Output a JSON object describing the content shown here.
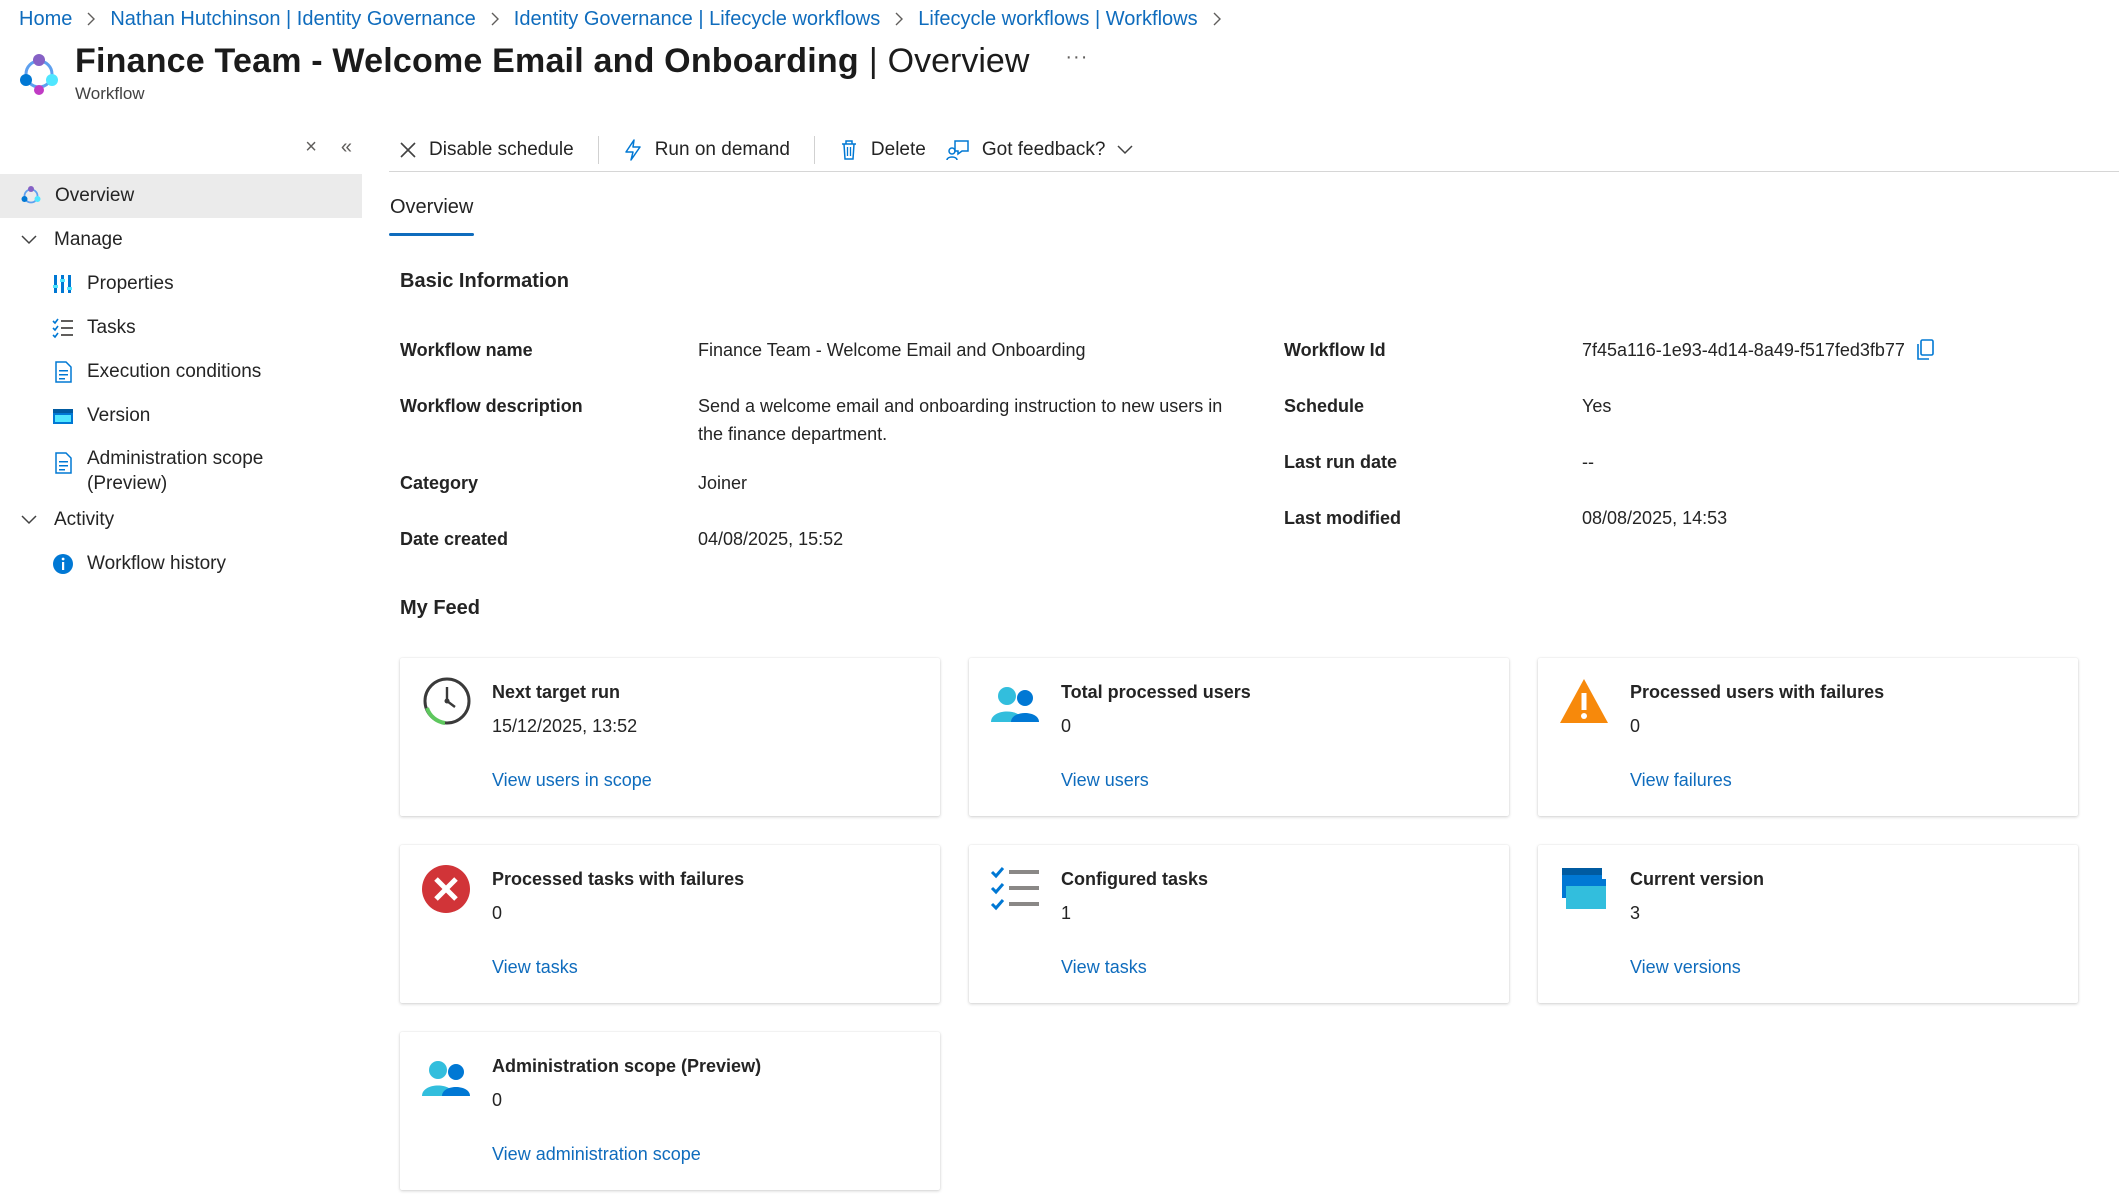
{
  "breadcrumb": [
    {
      "label": "Home"
    },
    {
      "label": "Nathan Hutchinson | Identity Governance"
    },
    {
      "label": "Identity Governance | Lifecycle workflows"
    },
    {
      "label": "Lifecycle workflows | Workflows"
    }
  ],
  "header": {
    "title": "Finance Team - Welcome Email and Onboarding",
    "separator": "|",
    "subtitle": "Overview",
    "kind": "Workflow",
    "more_label": "···"
  },
  "nav_controls": {
    "close": "×",
    "collapse": "«"
  },
  "sidenav": {
    "overview": "Overview",
    "manage": "Manage",
    "properties": "Properties",
    "tasks": "Tasks",
    "execution_conditions": "Execution conditions",
    "version": "Version",
    "admin_scope_line1": "Administration scope",
    "admin_scope_line2": "(Preview)",
    "activity": "Activity",
    "workflow_history": "Workflow history"
  },
  "toolbar": {
    "disable_schedule": "Disable schedule",
    "run_on_demand": "Run on demand",
    "delete": "Delete",
    "feedback": "Got feedback?"
  },
  "tabs": [
    {
      "label": "Overview"
    }
  ],
  "basic_info": {
    "title": "Basic Information",
    "workflow_name_label": "Workflow name",
    "workflow_name": "Finance Team - Welcome Email and Onboarding",
    "workflow_description_label": "Workflow description",
    "workflow_description_line1": "Send a welcome email and onboarding instruction to new users in",
    "workflow_description_line2": "the finance department.",
    "category_label": "Category",
    "category": "Joiner",
    "date_created_label": "Date created",
    "date_created": "04/08/2025, 15:52",
    "workflow_id_label": "Workflow Id",
    "workflow_id": "7f45a116-1e93-4d14-8a49-f517fed3fb77",
    "schedule_label": "Schedule",
    "schedule": "Yes",
    "last_run_date_label": "Last run date",
    "last_run_date": "--",
    "last_modified_label": "Last modified",
    "last_modified": "08/08/2025, 14:53"
  },
  "feed": {
    "title": "My Feed",
    "cards": [
      {
        "icon": "clock-icon",
        "title": "Next target run",
        "value": "15/12/2025, 13:52",
        "link": "View users in scope"
      },
      {
        "icon": "users-icon",
        "title": "Total processed users",
        "value": "0",
        "link": "View users"
      },
      {
        "icon": "warning-icon",
        "title": "Processed users with failures",
        "value": "0",
        "link": "View failures"
      },
      {
        "icon": "error-icon",
        "title": "Processed tasks with failures",
        "value": "0",
        "link": "View tasks"
      },
      {
        "icon": "task-list-icon",
        "title": "Configured tasks",
        "value": "1",
        "link": "View tasks"
      },
      {
        "icon": "version-icon",
        "title": "Current version",
        "value": "3",
        "link": "View versions"
      },
      {
        "icon": "admin-users-icon",
        "title": "Administration scope (Preview)",
        "value": "0",
        "link": "View administration scope"
      }
    ]
  },
  "colors": {
    "link": "#0f6cbd",
    "active_nav_bg": "#ebebeb",
    "warning": "#f7890b",
    "error": "#d13438"
  }
}
